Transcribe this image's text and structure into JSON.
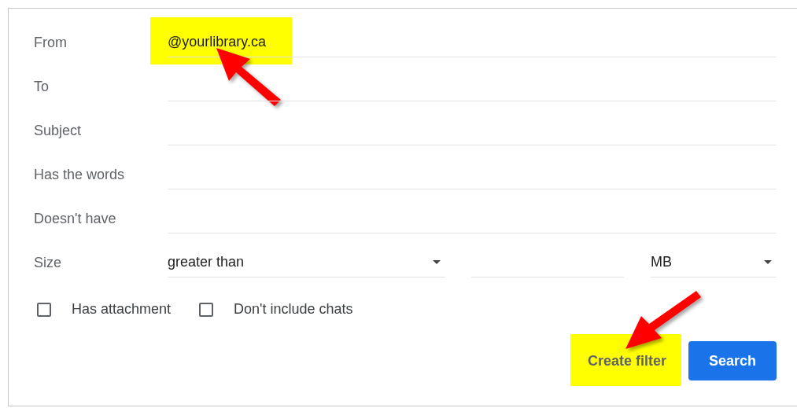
{
  "fields": [
    {
      "label": "From",
      "value": "@yourlibrary.ca",
      "highlighted": true,
      "arrow": true
    },
    {
      "label": "To"
    },
    {
      "label": "Subject"
    },
    {
      "label": "Has the words"
    },
    {
      "label": "Doesn't have"
    }
  ],
  "size": {
    "label": "Size",
    "operator": "greater than",
    "unit": "MB"
  },
  "checkboxes": [
    {
      "label": "Has attachment",
      "checked": false
    },
    {
      "label": "Don't include chats",
      "checked": false
    }
  ],
  "buttons": [
    {
      "label": "Create filter",
      "kind": "text",
      "highlighted": true,
      "arrow": true
    },
    {
      "label": "Search",
      "kind": "primary"
    }
  ]
}
